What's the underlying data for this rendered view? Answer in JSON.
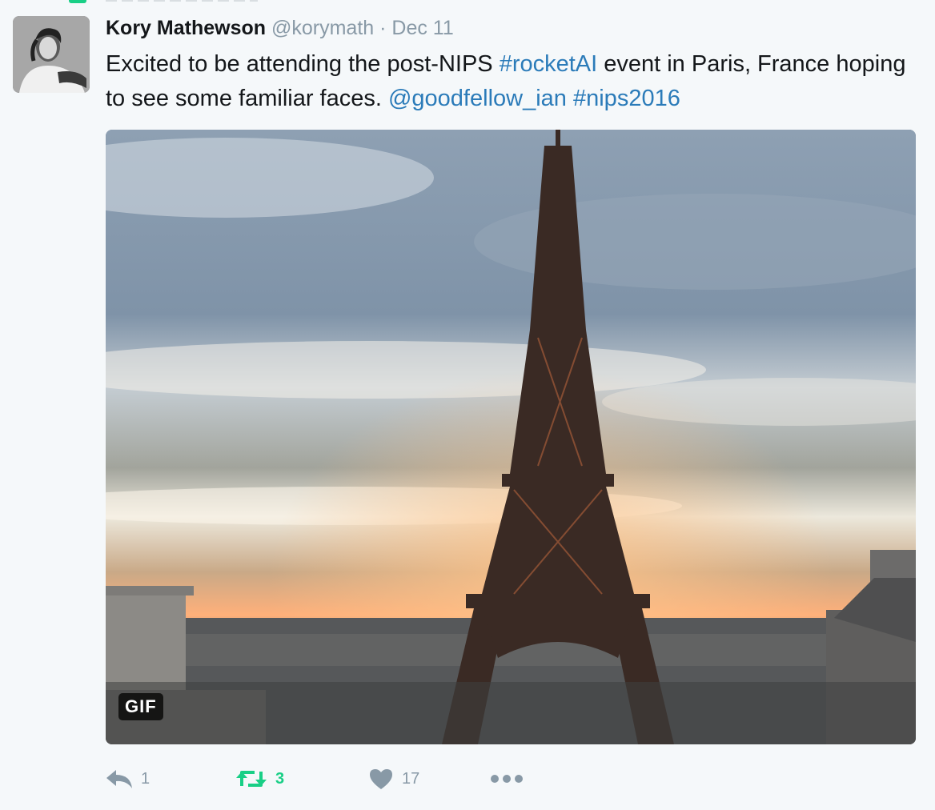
{
  "tweet": {
    "author_name": "Kory Mathewson",
    "handle": "@korymath",
    "separator": "·",
    "date": "Dec 11",
    "text_parts": {
      "t1": "Excited to be attending the post-NIPS ",
      "tag_rocketai": "#rocketAI",
      "t2": " event in Paris, France hoping to see some familiar faces. ",
      "mention": "@goodfellow_ian",
      "t3": " ",
      "tag_nips": "#nips2016"
    },
    "media": {
      "badge": "GIF"
    }
  },
  "actions": {
    "reply": {
      "icon": "reply-icon",
      "count": "1"
    },
    "retweet": {
      "icon": "retweet-icon",
      "count": "3",
      "active_color": "#19cf86"
    },
    "like": {
      "icon": "heart-icon",
      "count": "17"
    },
    "more": {
      "icon": "more-dots-icon"
    }
  },
  "colors": {
    "background": "#f5f8fa",
    "link": "#2b7bb9",
    "muted": "#8899a6",
    "retweet_active": "#19cf86"
  }
}
